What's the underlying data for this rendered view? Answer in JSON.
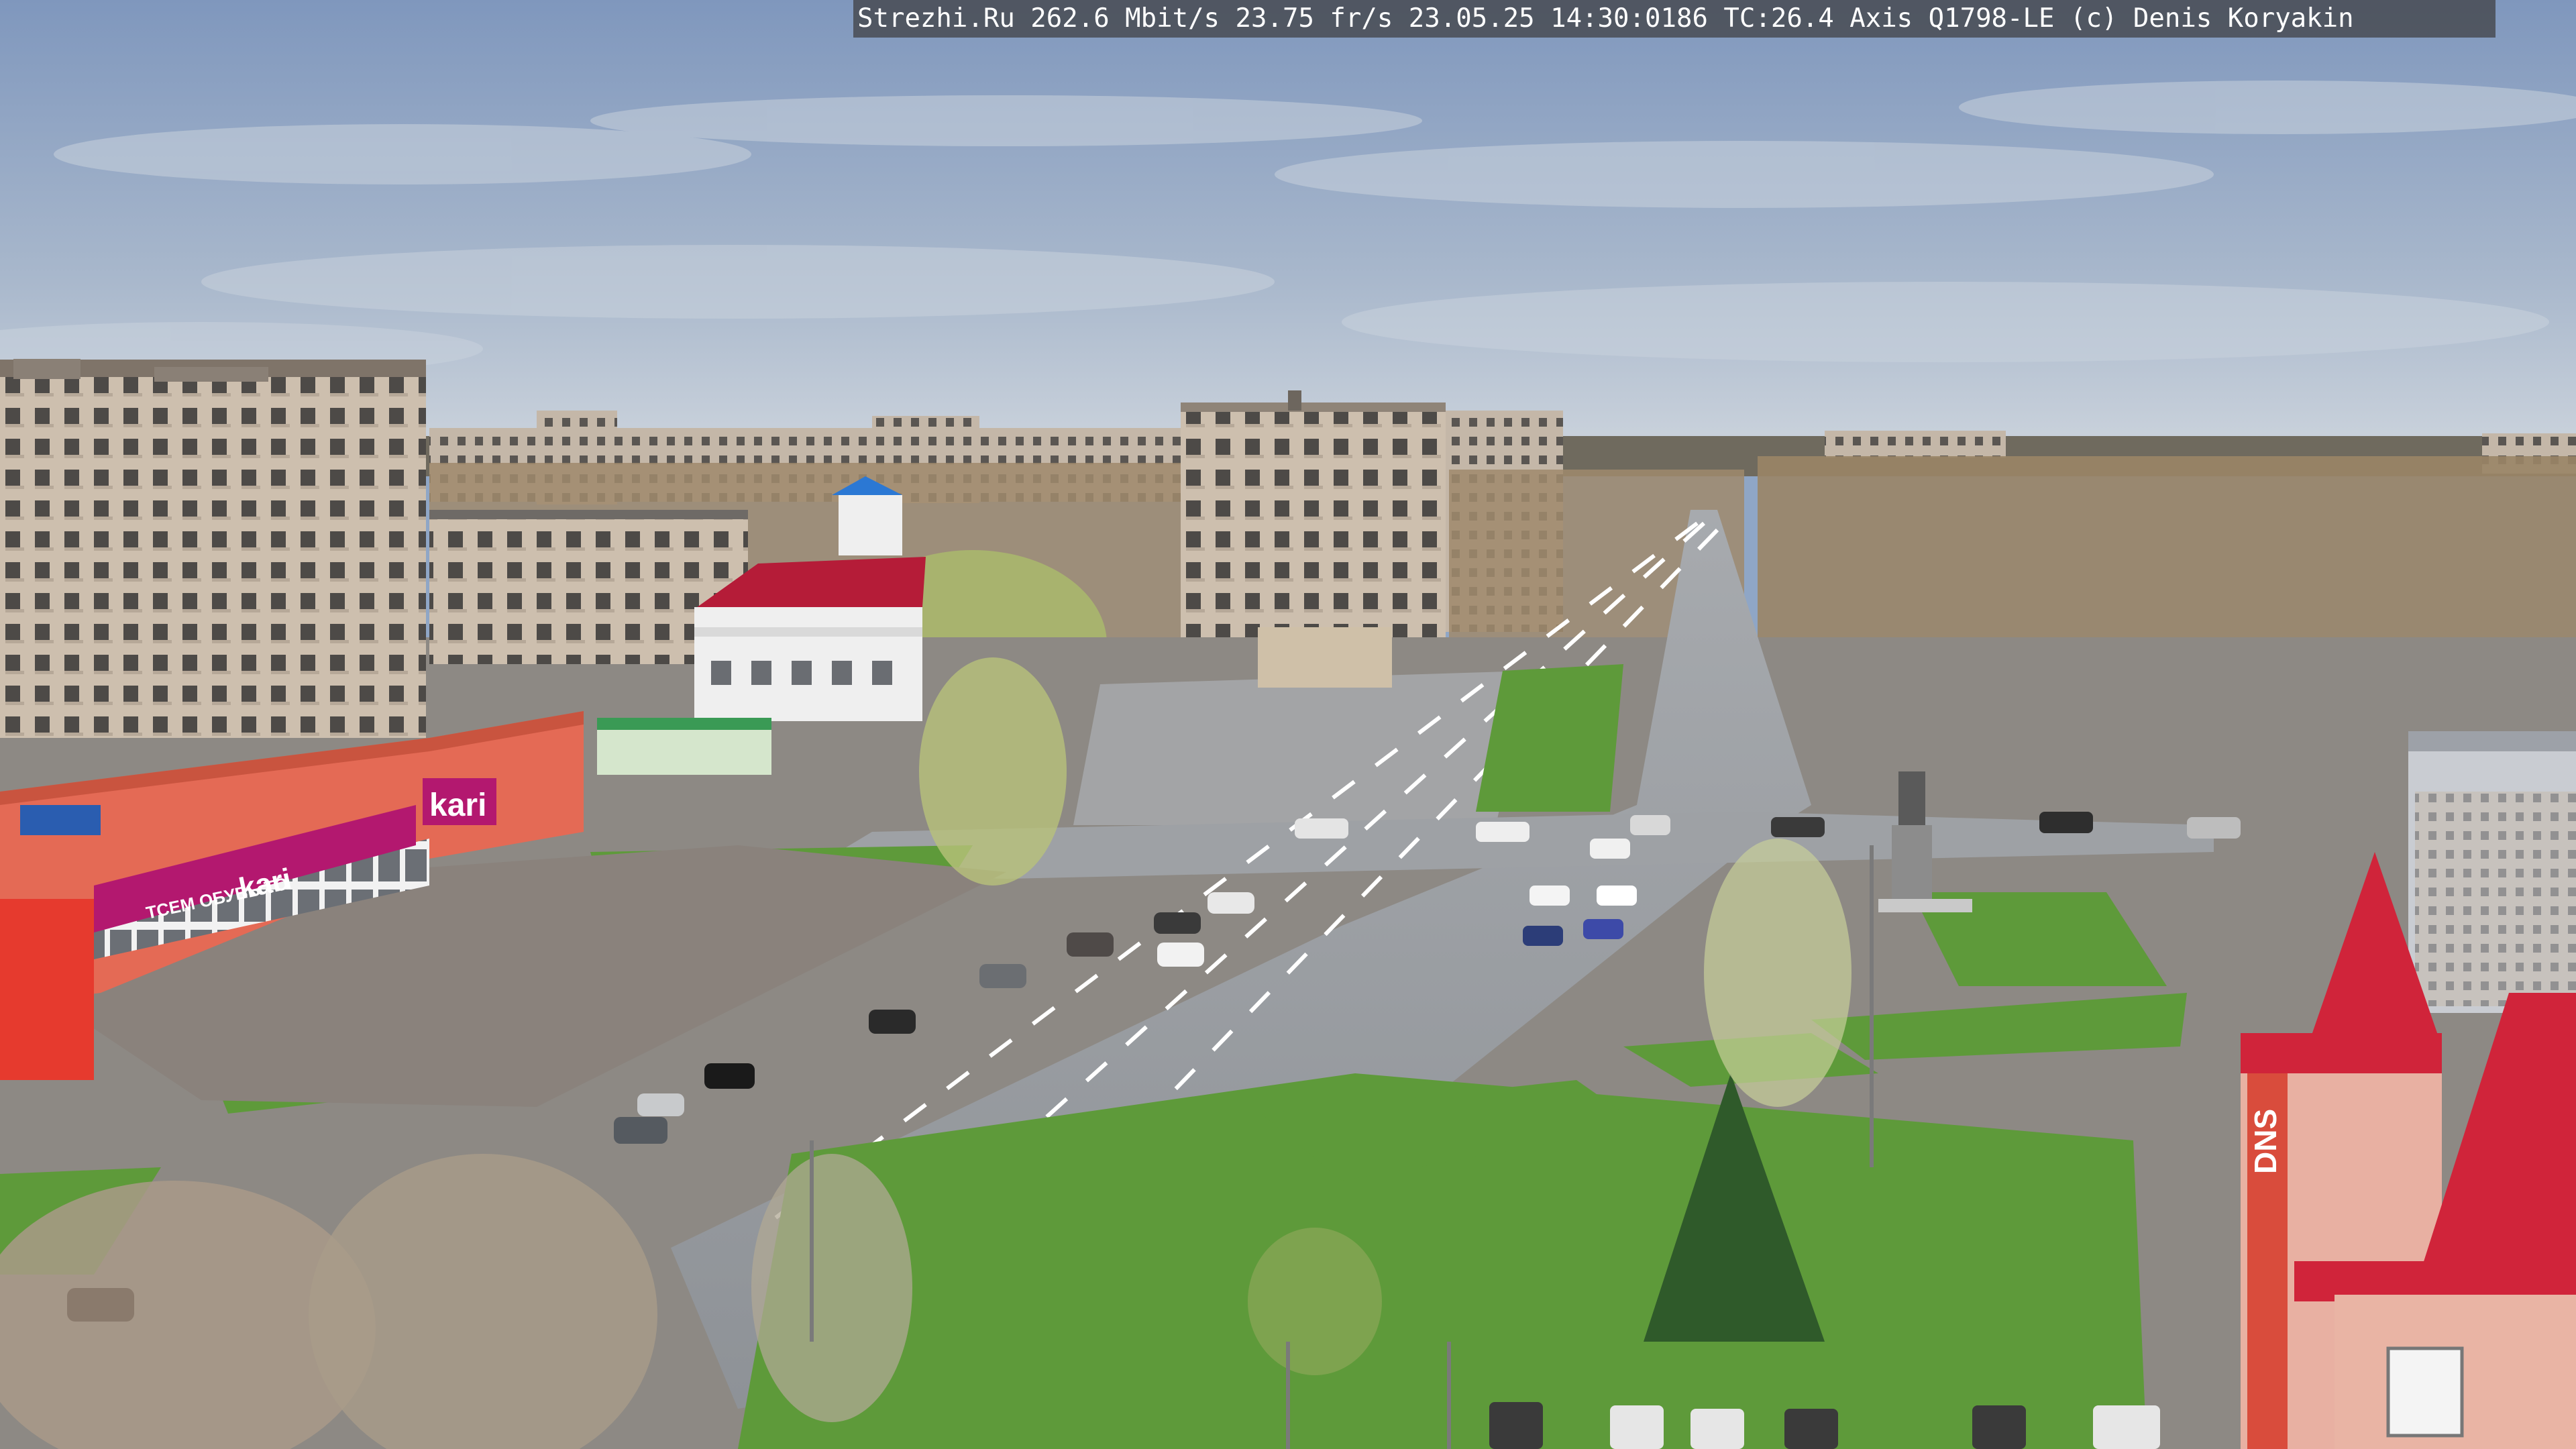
{
  "camera_overlay": {
    "text": "Strezhi.Ru 262.6 Mbit/s 23.75 fr/s 23.05.25 14:30:0186 TC:26.4  Axis Q1798-LE  (c) Denis Koryakin"
  },
  "signage": {
    "store_logo": "kari",
    "store_banner_logo": "kari",
    "store_banner_prefix": "ТСЕМ ОБУВЬ ТО",
    "shop_tower_sign": "DNS"
  },
  "colors": {
    "sky_top": "#7f97bd",
    "sky_bottom": "#c9d2dc",
    "road": "#9a9ea3",
    "grass": "#5e9a3a",
    "store_facade": "#e46a55",
    "store_banner": "#b3186f",
    "roof_red": "#d0243a",
    "panel_buildings": "#c7b8a6",
    "trees_bare": "#a08a6c"
  }
}
